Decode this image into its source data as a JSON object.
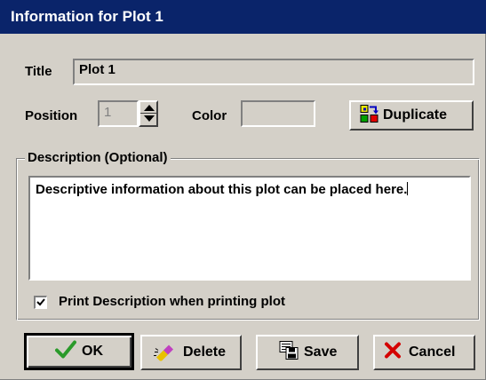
{
  "window": {
    "title": "Information for Plot 1"
  },
  "title_field": {
    "label": "Title",
    "value": "Plot 1"
  },
  "position_field": {
    "label": "Position",
    "value": "1"
  },
  "color_field": {
    "label": "Color",
    "value": ""
  },
  "buttons": {
    "duplicate": "Duplicate",
    "ok": "OK",
    "delete": "Delete",
    "save": "Save",
    "cancel": "Cancel"
  },
  "description": {
    "group_title": "Description (Optional)",
    "text": "Descriptive information about this plot can be placed here."
  },
  "print_option": {
    "label": "Print Description when printing plot",
    "checked": true
  },
  "colors": {
    "titlebar": "#0a246a",
    "face": "#d4d0c8",
    "ok_check": "#2a9a2a",
    "cancel_x": "#d40000"
  }
}
